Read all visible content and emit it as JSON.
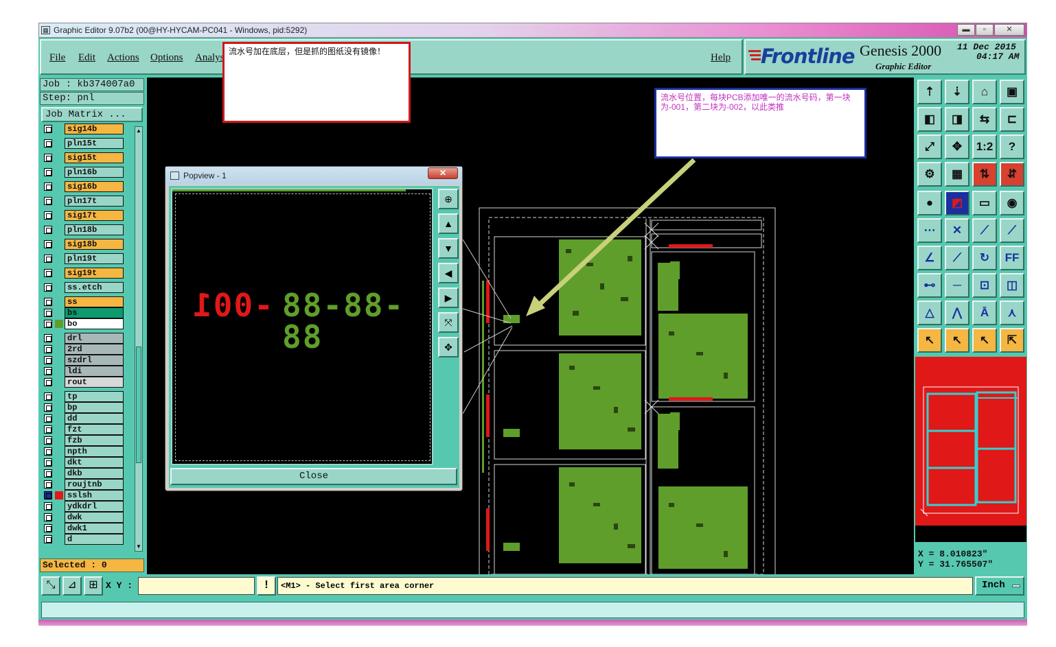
{
  "window": {
    "title": "Graphic Editor 9.07b2 (00@HY-HYCAM-PC041 - Windows, pid:5292)",
    "min_label": "▬",
    "max_label": "▫",
    "close_label": "✕"
  },
  "menu": {
    "file": "File",
    "edit": "Edit",
    "actions": "Actions",
    "options": "Options",
    "analysis": "Analys",
    "help": "Help"
  },
  "brand": {
    "logo": "Frontline",
    "product": "Genesis 2000",
    "subtitle": "Graphic Editor",
    "date": "11 Dec 2015",
    "time": "04:17 AM"
  },
  "job": {
    "job_label": "Job : kb374007a0",
    "step_label": "Step: pnl",
    "matrix_button": "Job Matrix ..."
  },
  "layers": [
    {
      "name": "sig14b",
      "color": "#f5b642"
    },
    {
      "name": "pln15t",
      "color": "#9ad6c8"
    },
    {
      "name": "sig15t",
      "color": "#f5b642"
    },
    {
      "name": "pln16b",
      "color": "#9ad6c8"
    },
    {
      "name": "sig16b",
      "color": "#f5b642"
    },
    {
      "name": "pln17t",
      "color": "#9ad6c8"
    },
    {
      "name": "sig17t",
      "color": "#f5b642"
    },
    {
      "name": "pln18b",
      "color": "#9ad6c8"
    },
    {
      "name": "sig18b",
      "color": "#f5b642"
    },
    {
      "name": "pln19t",
      "color": "#9ad6c8"
    },
    {
      "name": "sig19t",
      "color": "#f5b642"
    },
    {
      "name": "ss.etch",
      "color": "#9ad6c8"
    },
    {
      "name": "ss",
      "color": "#f5b642"
    },
    {
      "name": "bs",
      "color": "#0c9a6e"
    },
    {
      "name": "bo",
      "color": "#ffffff"
    },
    {
      "name": "drl",
      "color": "#a8b8b8"
    },
    {
      "name": "2rd",
      "color": "#a8b8b8"
    },
    {
      "name": "szdrl",
      "color": "#a8b8b8"
    },
    {
      "name": "ldi",
      "color": "#a8b8b8"
    },
    {
      "name": "rout",
      "color": "#d8d8d8"
    },
    {
      "name": "tp",
      "color": "#9ad6c8"
    },
    {
      "name": "bp",
      "color": "#9ad6c8"
    },
    {
      "name": "dd",
      "color": "#9ad6c8"
    },
    {
      "name": "fzt",
      "color": "#9ad6c8"
    },
    {
      "name": "fzb",
      "color": "#9ad6c8"
    },
    {
      "name": "npth",
      "color": "#9ad6c8"
    },
    {
      "name": "dkt",
      "color": "#9ad6c8"
    },
    {
      "name": "dkb",
      "color": "#9ad6c8"
    },
    {
      "name": "roujtnb",
      "color": "#9ad6c8"
    },
    {
      "name": "sslsh",
      "color": "#9ad6c8"
    },
    {
      "name": "ydkdrl",
      "color": "#9ad6c8"
    },
    {
      "name": "dwk",
      "color": "#9ad6c8"
    },
    {
      "name": "dwk1",
      "color": "#9ad6c8"
    },
    {
      "name": "d",
      "color": "#9ad6c8"
    }
  ],
  "selected": "Selected : 0",
  "popview": {
    "title": "Popview - 1",
    "close_x": "✕",
    "close_button": "Close",
    "serial_red": "-001",
    "serial_green": "88-88-88"
  },
  "notes": {
    "note1": "流水号加在底层，但是抓的图纸没有镜像！",
    "note2": "流水号位置，每块PCB添加唯一的流水号码，第一块为-001，第二块为-002，以此类推"
  },
  "bottom": {
    "xy_label": "X Y :",
    "xy_value": "",
    "excl": "!",
    "prompt": "<M1> - Select first area corner",
    "units": "Inch"
  },
  "coords": {
    "x": "X  = 8.010823\"",
    "y": "Y  = 31.765507\""
  },
  "colors": {
    "panel": "#56c8b0",
    "button": "#9ad6c8",
    "orange": "#f5b642",
    "copper": "#5f9e2a",
    "red": "#e01818"
  }
}
